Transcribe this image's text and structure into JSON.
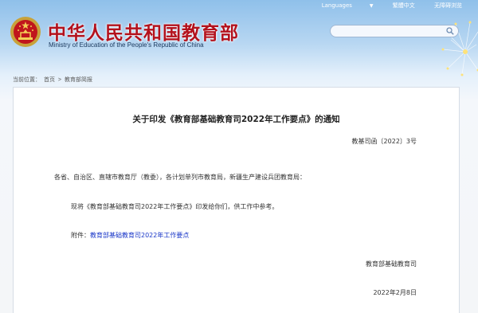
{
  "header": {
    "logo_cn": "中华人民共和国教育部",
    "logo_en": "Ministry of Education of the People's Republic of China",
    "links": [
      {
        "label": "Languages"
      },
      {
        "label": "繁體中文"
      },
      {
        "label": "无障碍浏览"
      }
    ],
    "search": {
      "placeholder": "",
      "value": ""
    }
  },
  "breadcrumb": {
    "prefix": "当前位置：",
    "items": [
      "首页",
      "教育部简报"
    ],
    "sep": ">"
  },
  "article": {
    "title": "关于印发《教育部基础教育司2022年工作要点》的通知",
    "doc_no": "教基司函〔2022〕3号",
    "recipients": "各省、自治区、直辖市教育厅（教委），各计划单列市教育局，新疆生产建设兵团教育局：",
    "body": "现将《教育部基础教育司2022年工作要点》印发给你们，供工作中参考。",
    "attachment_label": "附件：",
    "attachment_link": "教育部基础教育司2022年工作要点",
    "signature": "教育部基础教育司",
    "date": "2022年2月8日"
  },
  "colors": {
    "logo": "#b3121d",
    "link": "#1a37c8",
    "sky": "#8fc0ea"
  }
}
